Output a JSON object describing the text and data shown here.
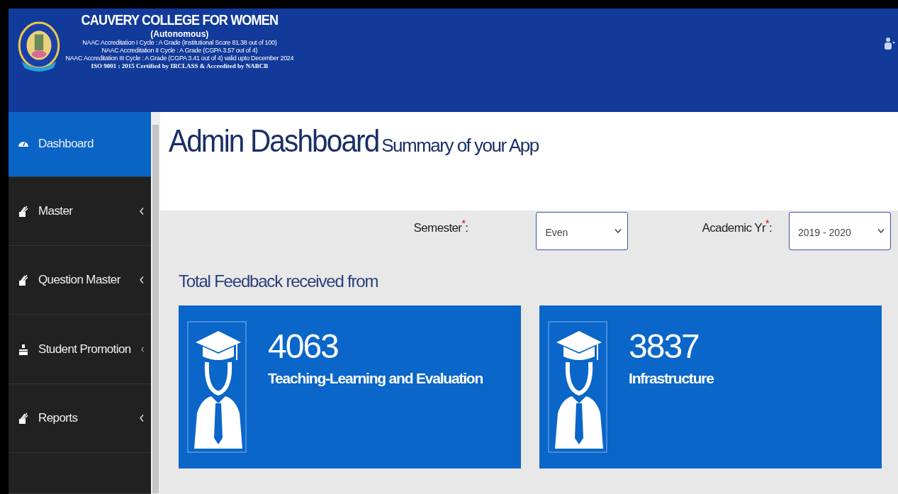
{
  "header": {
    "college": "CAUVERY COLLEGE FOR WOMEN",
    "subtitle": "(Autonomous)",
    "accreditations": [
      "NAAC Accreditation I Cycle : A Grade (Institutional Score 81.38 out of 100)",
      "NAAC Accreditation II Cycle : A Grade (CGPA 3.57 out of 4)",
      "NAAC Accreditation III Cycle : A Grade (CGPA 3.41 out of 4) valid upto December 2024"
    ],
    "iso": "ISO 9001 : 2015 Certified by IRCLASS & Accredited by NABCB"
  },
  "sidebar": {
    "items": [
      {
        "label": "Dashboard",
        "kind": "dashboard",
        "selected": true,
        "expandable": false
      },
      {
        "label": "Master",
        "kind": "pen",
        "selected": false,
        "expandable": true
      },
      {
        "label": "Question Master",
        "kind": "pen",
        "selected": false,
        "expandable": true
      },
      {
        "label": "Student Promotion",
        "kind": "sitemap",
        "selected": false,
        "expandable": true
      },
      {
        "label": "Reports",
        "kind": "pen",
        "selected": false,
        "expandable": true
      }
    ]
  },
  "page": {
    "title": "Admin Dashboard",
    "subtitle": "Summary of your App"
  },
  "filters": [
    {
      "label": "Semester$^{*}$:",
      "value": "Even"
    },
    {
      "label": "Academic Yr$^{*}$:",
      "value": "2019 - 2020"
    }
  ],
  "section_title": "Total Feedback received from",
  "cards": [
    {
      "count": "4063",
      "label": "Teaching-Learning and Evaluation"
    },
    {
      "count": "3837",
      "label": "Infrastructure"
    }
  ]
}
